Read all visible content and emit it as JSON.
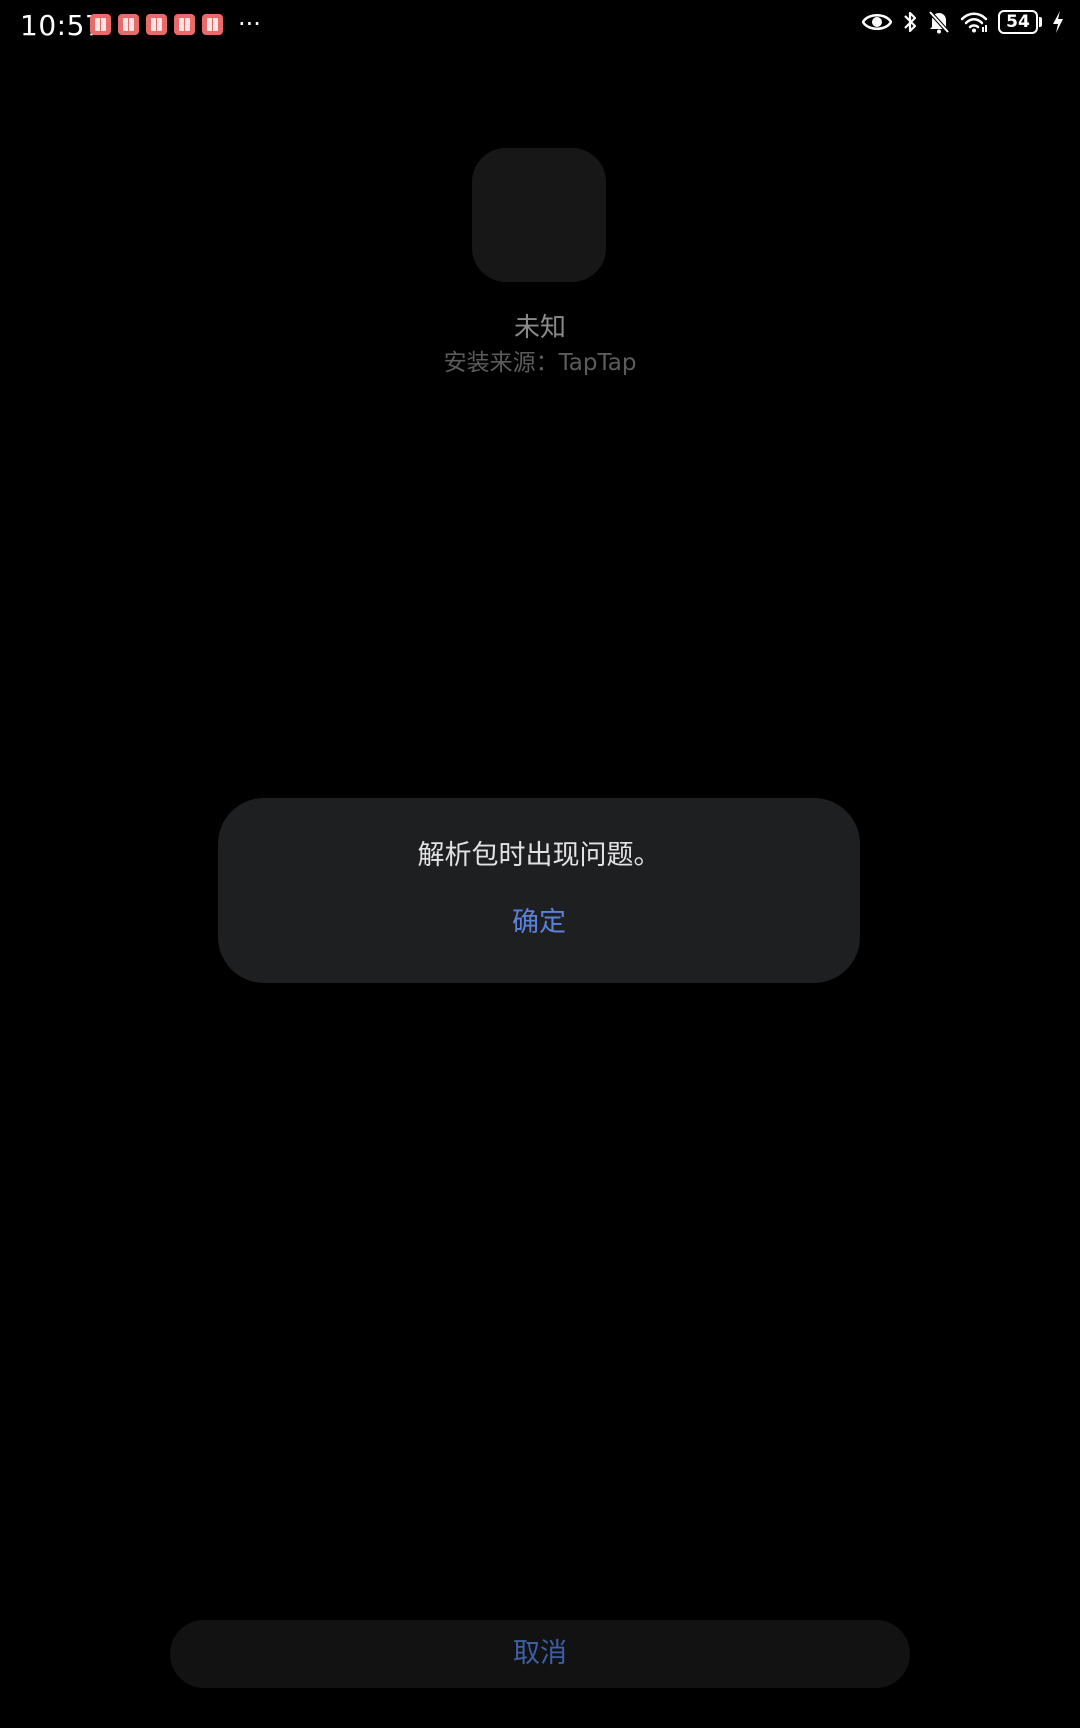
{
  "status_bar": {
    "time": "10:57",
    "notification_icons": [
      "book-notification-icon",
      "book-notification-icon",
      "book-notification-icon",
      "book-notification-icon",
      "book-notification-icon"
    ],
    "more_indicator": "···",
    "battery_level": "54",
    "system_icons": [
      "eye-icon",
      "bluetooth-icon",
      "bell-off-icon",
      "wifi-icon",
      "battery-icon",
      "charging-icon"
    ]
  },
  "app": {
    "name": "未知",
    "install_source": "安装来源：TapTap"
  },
  "dialog": {
    "message": "解析包时出现问题。",
    "confirm_label": "确定"
  },
  "bottom": {
    "cancel_label": "取消"
  },
  "colors": {
    "background": "#000000",
    "dialog_bg": "#1e1f21",
    "accent": "#5b82d8",
    "notif_icon": "#e86b6b"
  }
}
